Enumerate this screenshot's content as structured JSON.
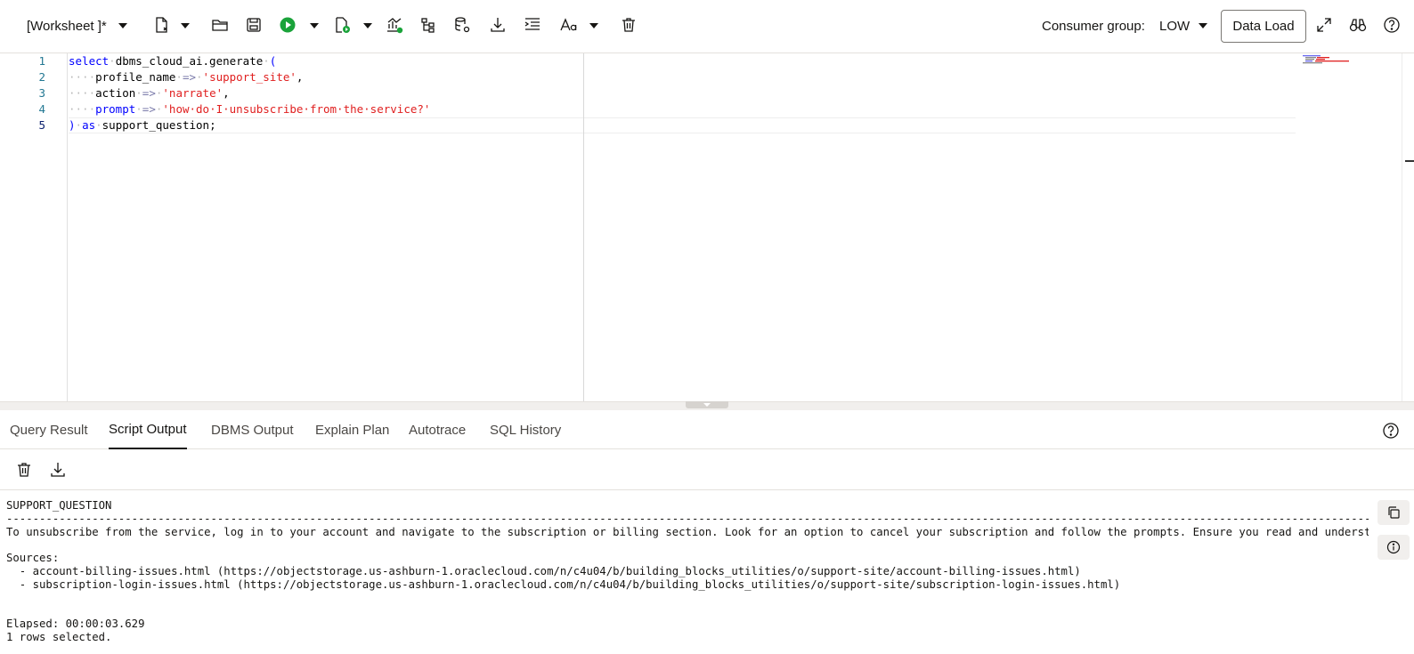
{
  "toolbar": {
    "worksheet_title": "[Worksheet ]*",
    "consumer_group_label": "Consumer group:",
    "consumer_group_value": "LOW",
    "data_load_label": "Data Load"
  },
  "editor": {
    "line_numbers": [
      "1",
      "2",
      "3",
      "4",
      "5"
    ],
    "lines": [
      [
        {
          "t": "select",
          "c": "kw"
        },
        {
          "t": "·",
          "c": "dots"
        },
        {
          "t": "dbms_cloud_ai.generate",
          "c": "id"
        },
        {
          "t": "·",
          "c": "dots"
        },
        {
          "t": "(",
          "c": "kw"
        }
      ],
      [
        {
          "t": "····",
          "c": "dots"
        },
        {
          "t": "profile_name",
          "c": "id"
        },
        {
          "t": "·",
          "c": "dots"
        },
        {
          "t": "=>",
          "c": "op"
        },
        {
          "t": "·",
          "c": "dots"
        },
        {
          "t": "'support_site'",
          "c": "str"
        },
        {
          "t": ",",
          "c": "id"
        }
      ],
      [
        {
          "t": "····",
          "c": "dots"
        },
        {
          "t": "action",
          "c": "id"
        },
        {
          "t": "·",
          "c": "dots"
        },
        {
          "t": "=>",
          "c": "op"
        },
        {
          "t": "·",
          "c": "dots"
        },
        {
          "t": "'narrate'",
          "c": "str"
        },
        {
          "t": ",",
          "c": "id"
        }
      ],
      [
        {
          "t": "····",
          "c": "dots"
        },
        {
          "t": "prompt",
          "c": "kw"
        },
        {
          "t": "·",
          "c": "dots"
        },
        {
          "t": "=>",
          "c": "op"
        },
        {
          "t": "·",
          "c": "dots"
        },
        {
          "t": "'how·do·I·unsubscribe·from·the·service?'",
          "c": "str"
        }
      ],
      [
        {
          "t": ")",
          "c": "kw"
        },
        {
          "t": "·",
          "c": "dots"
        },
        {
          "t": "as",
          "c": "kw"
        },
        {
          "t": "·",
          "c": "dots"
        },
        {
          "t": "support_question;",
          "c": "id"
        }
      ]
    ]
  },
  "tabs": {
    "query_result": "Query Result",
    "script_output": "Script Output",
    "dbms_output": "DBMS Output",
    "explain_plan": "Explain Plan",
    "autotrace": "Autotrace",
    "sql_history": "SQL History"
  },
  "output": {
    "column_header": "SUPPORT_QUESTION",
    "separator": "-----------------------------------------------------------------------------------------------------------------------------------------------------------------------------------------------------------------------------------------------------",
    "answer": "To unsubscribe from the service, log in to your account and navigate to the subscription or billing section. Look for an option to cancel your subscription and follow the prompts. Ensure you read and understand any",
    "sources_label": "Sources:",
    "source_1": "  - account-billing-issues.html (https://objectstorage.us-ashburn-1.oraclecloud.com/n/c4u04/b/building_blocks_utilities/o/support-site/account-billing-issues.html)",
    "source_2": "  - subscription-login-issues.html (https://objectstorage.us-ashburn-1.oraclecloud.com/n/c4u04/b/building_blocks_utilities/o/support-site/subscription-login-issues.html)",
    "elapsed": "Elapsed: 00:00:03.629",
    "rows_selected": "1 rows selected."
  },
  "colors": {
    "keyword": "#0000ff",
    "string": "#e02020",
    "run_green": "#1aa33a",
    "line_number": "#237893"
  }
}
